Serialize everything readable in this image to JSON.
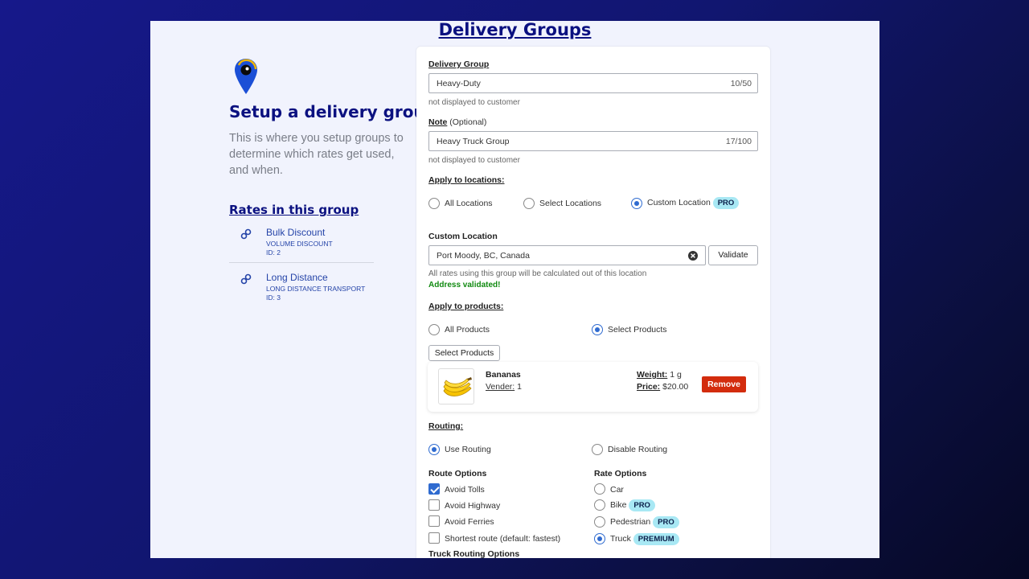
{
  "page": {
    "title": "Delivery Groups"
  },
  "intro": {
    "heading": "Setup a delivery group",
    "description": "This is where you setup groups to determine which rates get used, and when.",
    "rates_heading": "Rates in this group"
  },
  "rates": [
    {
      "name": "Bulk Discount",
      "subtitle": "VOLUME DISCOUNT",
      "id_text": "ID: 2",
      "icon": "link-icon"
    },
    {
      "name": "Long Distance",
      "subtitle": "LONG DISTANCE TRANSPORT",
      "id_text": "ID: 3",
      "icon": "link-icon"
    }
  ],
  "form": {
    "delivery_group": {
      "label": "Delivery Group",
      "value": "Heavy-Duty",
      "counter": "10/50",
      "hint": "not displayed to customer"
    },
    "note": {
      "label": "Note",
      "optional": "(Optional)",
      "value": "Heavy Truck Group",
      "counter": "17/100",
      "hint": "not displayed to customer"
    },
    "locations": {
      "label": "Apply to locations:",
      "options": [
        "All Locations",
        "Select Locations",
        "Custom Location"
      ],
      "selected": "Custom Location",
      "custom_badge": "PRO"
    },
    "custom_location": {
      "label": "Custom Location",
      "value": "Port Moody, BC, Canada",
      "validate_label": "Validate",
      "hint": "All rates using this group will be calculated out of this location",
      "status": "Address validated!"
    },
    "products": {
      "label": "Apply to products:",
      "options": [
        "All Products",
        "Select Products"
      ],
      "selected": "Select Products",
      "select_button": "Select Products",
      "items": [
        {
          "name": "Bananas",
          "vendor_label": "Vender:",
          "vendor_value": "1",
          "weight_label": "Weight:",
          "weight_value": "1 g",
          "price_label": "Price:",
          "price_value": "$20.00",
          "remove_label": "Remove"
        }
      ]
    },
    "routing": {
      "label": "Routing:",
      "options": [
        "Use Routing",
        "Disable Routing"
      ],
      "selected": "Use Routing"
    },
    "route_options": {
      "label": "Route Options",
      "items": [
        {
          "label": "Avoid Tolls",
          "checked": true
        },
        {
          "label": "Avoid Highway",
          "checked": false
        },
        {
          "label": "Avoid Ferries",
          "checked": false
        },
        {
          "label": "Shortest route (default: fastest)",
          "checked": false
        }
      ]
    },
    "rate_options": {
      "label": "Rate Options",
      "items": [
        {
          "label": "Car",
          "badge": ""
        },
        {
          "label": "Bike",
          "badge": "PRO"
        },
        {
          "label": "Pedestrian",
          "badge": "PRO"
        },
        {
          "label": "Truck",
          "badge": "PREMIUM"
        }
      ],
      "selected": "Truck"
    },
    "truck_routing": {
      "label": "Truck Routing Options"
    }
  },
  "colors": {
    "brand_navy": "#0b1180",
    "link_blue": "#2544a8",
    "accent_blue": "#2f6bd0",
    "badge_bg": "#a8e8f4",
    "danger": "#d32c0d",
    "success": "#118a11"
  }
}
